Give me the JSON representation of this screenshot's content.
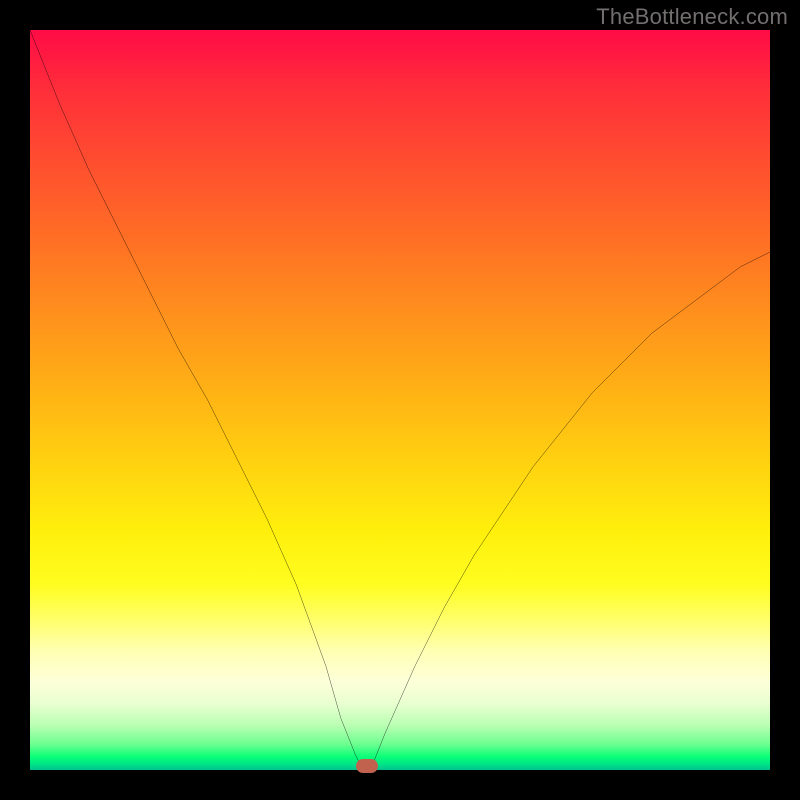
{
  "watermark": "TheBottleneck.com",
  "chart_data": {
    "type": "line",
    "title": "",
    "xlabel": "",
    "ylabel": "",
    "xlim": [
      0,
      100
    ],
    "ylim": [
      0,
      100
    ],
    "x": [
      0,
      4,
      8,
      12,
      16,
      20,
      24,
      28,
      32,
      36,
      40,
      42,
      44,
      45,
      46,
      48,
      52,
      56,
      60,
      64,
      68,
      72,
      76,
      80,
      84,
      88,
      92,
      96,
      100
    ],
    "series": [
      {
        "name": "bottleneck-curve",
        "values": [
          100,
          90,
          81,
          73,
          65,
          57,
          50,
          42,
          34,
          25,
          14,
          7,
          2,
          0,
          0,
          5,
          14,
          22,
          29,
          35,
          41,
          46,
          51,
          55,
          59,
          62,
          65,
          68,
          70
        ]
      }
    ],
    "annotations": [
      {
        "name": "optimal-marker",
        "x": 45.5,
        "y": 0
      }
    ],
    "gradient_stops": [
      {
        "pos": 0,
        "color": "#ff0b46"
      },
      {
        "pos": 50,
        "color": "#ffd010"
      },
      {
        "pos": 85,
        "color": "#fdffd8"
      },
      {
        "pos": 100,
        "color": "#00c28f"
      }
    ]
  }
}
